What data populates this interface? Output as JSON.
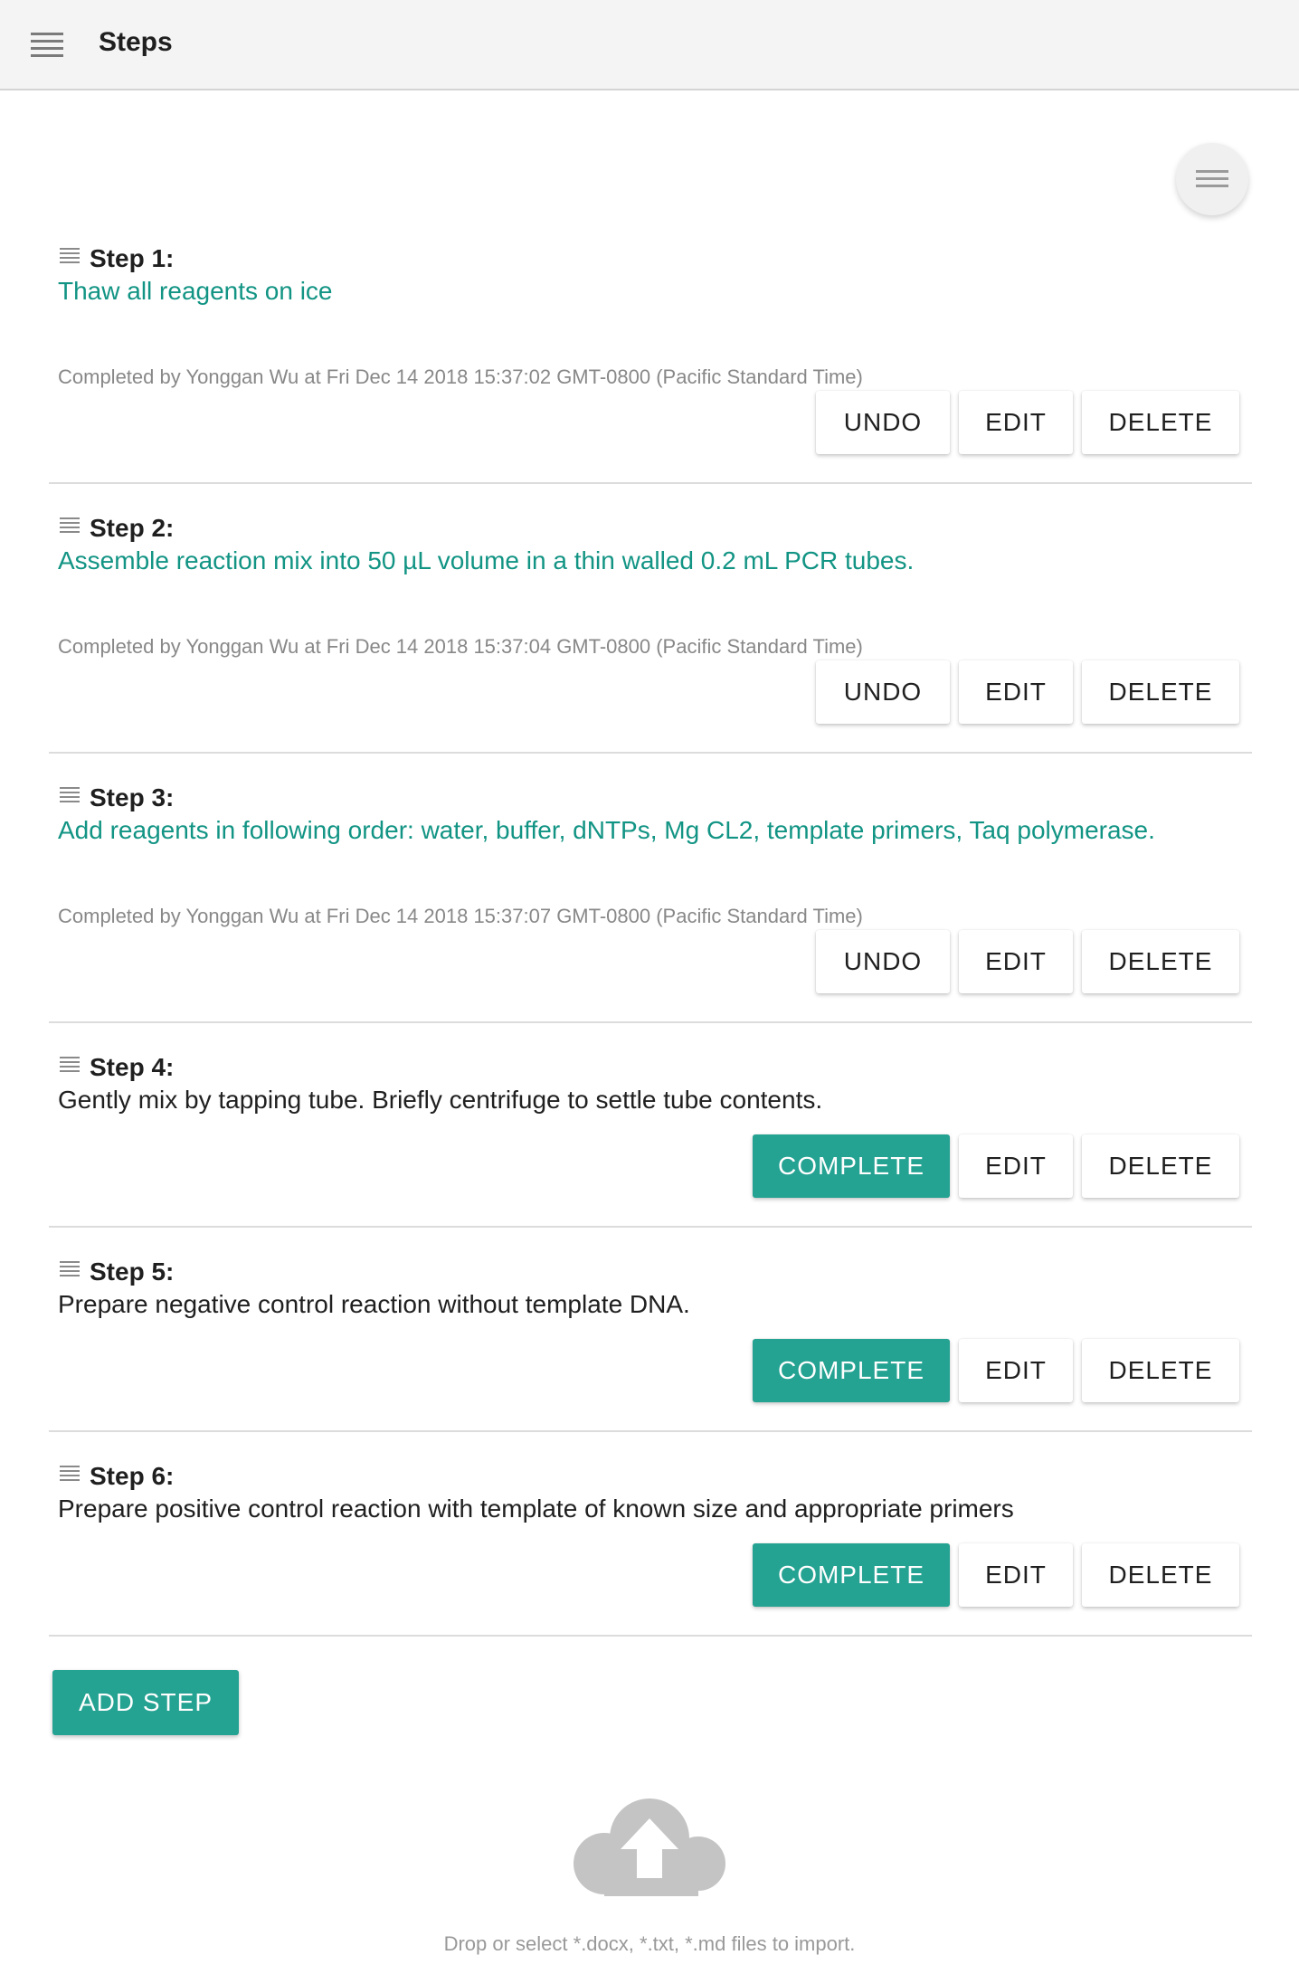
{
  "header": {
    "title": "Steps",
    "menu_icon": "hamburger-menu-icon"
  },
  "fab": {
    "icon": "menu-icon"
  },
  "steps": [
    {
      "label": "Step 1:",
      "text": "Thaw all reagents on ice",
      "completed": true,
      "completed_info": "Completed by Yonggan Wu at Fri Dec 14 2018 15:37:02 GMT-0800 (Pacific Standard Time)",
      "actions": [
        "UNDO",
        "EDIT",
        "DELETE"
      ]
    },
    {
      "label": "Step 2:",
      "text": "Assemble reaction mix into 50 µL volume in a thin walled 0.2 mL PCR tubes.",
      "completed": true,
      "completed_info": "Completed by Yonggan Wu at Fri Dec 14 2018 15:37:04 GMT-0800 (Pacific Standard Time)",
      "actions": [
        "UNDO",
        "EDIT",
        "DELETE"
      ]
    },
    {
      "label": "Step 3:",
      "text": "Add reagents in following order: water, buffer, dNTPs, Mg CL2, template primers, Taq polymerase.",
      "completed": true,
      "completed_info": "Completed by Yonggan Wu at Fri Dec 14 2018 15:37:07 GMT-0800 (Pacific Standard Time)",
      "actions": [
        "UNDO",
        "EDIT",
        "DELETE"
      ]
    },
    {
      "label": "Step 4:",
      "text": "Gently mix by tapping tube. Briefly centrifuge to settle tube contents.",
      "completed": false,
      "actions": [
        "COMPLETE",
        "EDIT",
        "DELETE"
      ]
    },
    {
      "label": "Step 5:",
      "text": "Prepare negative control reaction without template DNA.",
      "completed": false,
      "actions": [
        "COMPLETE",
        "EDIT",
        "DELETE"
      ]
    },
    {
      "label": "Step 6:",
      "text": "Prepare positive control reaction with template of known size and appropriate primers",
      "completed": false,
      "actions": [
        "COMPLETE",
        "EDIT",
        "DELETE"
      ]
    }
  ],
  "add_step_label": "ADD STEP",
  "import": {
    "icon": "cloud-upload-icon",
    "text": "Drop or select *.docx, *.txt, *.md files to import."
  },
  "colors": {
    "accent": "#24a292",
    "completed_text": "#129484"
  }
}
